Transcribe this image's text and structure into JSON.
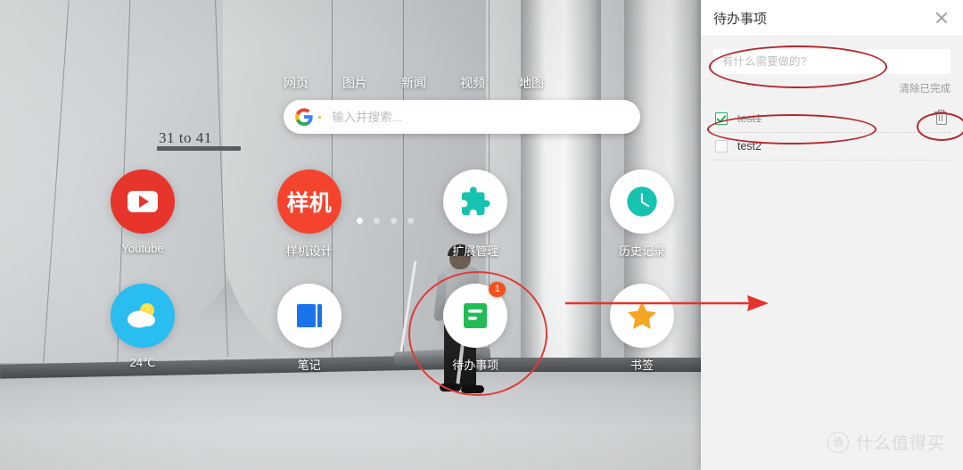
{
  "background": {
    "scene_sign_text": "31 to 41"
  },
  "search": {
    "tabs": [
      "网页",
      "图片",
      "新闻",
      "视频",
      "地图"
    ],
    "placeholder": "输入并搜索...",
    "value": "",
    "engine_icon": "google-logo-icon"
  },
  "apps": {
    "row1": [
      {
        "label": "Youtube",
        "icon": "youtube-icon",
        "badge": ""
      },
      {
        "label": "样机设计",
        "icon": "mockup-icon",
        "icon_text": "样机",
        "badge": ""
      },
      {
        "label": "扩展管理",
        "icon": "puzzle-extension-icon",
        "badge": ""
      },
      {
        "label": "历史记录",
        "icon": "clock-history-icon",
        "badge": ""
      }
    ],
    "row2": [
      {
        "label": "24℃",
        "icon": "weather-sun-cloud-icon",
        "badge": ""
      },
      {
        "label": "笔记",
        "icon": "notebook-icon",
        "badge": ""
      },
      {
        "label": "待办事项",
        "icon": "todo-list-icon",
        "badge": "1"
      },
      {
        "label": "书签",
        "icon": "star-bookmark-icon",
        "badge": ""
      }
    ],
    "pagination": {
      "count": 4,
      "active_index": 0
    }
  },
  "panel": {
    "title": "待办事项",
    "close_icon": "close-x-icon",
    "input_placeholder": "有什么需要做的?",
    "input_value": "",
    "clear_completed_label": "清除已完成",
    "delete_icon": "trash-icon",
    "items": [
      {
        "text": "test1",
        "done": true,
        "has_delete": true
      },
      {
        "text": "test2",
        "done": false,
        "has_delete": false
      }
    ]
  },
  "annotations": {
    "accent_color": "#b5272d",
    "arrow_color": "#e5342c",
    "circle_color": "#e03a37",
    "shapes": [
      "ellipse-around-todo-input",
      "ellipse-around-test1-item",
      "ellipse-around-trash-icon",
      "circle-around-todo-app-icon",
      "arrow-pointing-to-panel"
    ]
  },
  "watermark": {
    "badge": "值",
    "text": "什么值得买"
  }
}
